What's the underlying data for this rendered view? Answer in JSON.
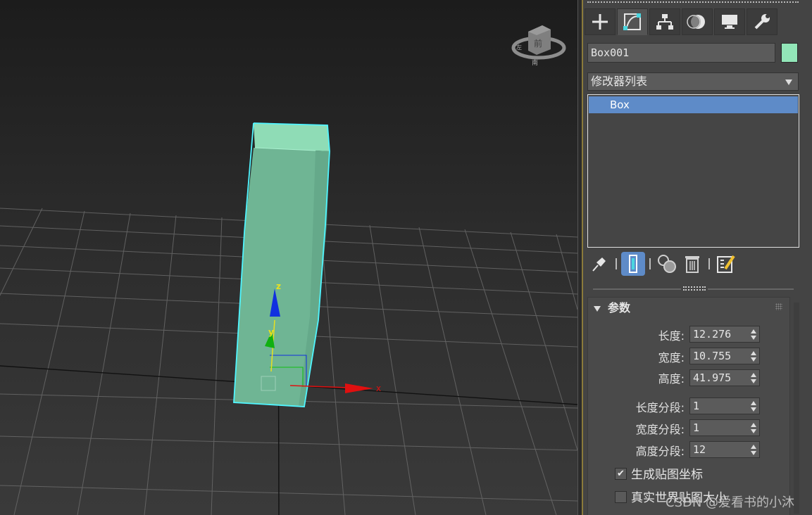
{
  "viewport": {
    "gizmo_axes": {
      "z": "z",
      "y": "y",
      "x": "x"
    },
    "viewcube": {
      "face_label": "前",
      "top_label": "左",
      "bottom_label": "南"
    }
  },
  "command_panel": {
    "tabs": [
      {
        "name": "create-tab",
        "icon": "plus-icon"
      },
      {
        "name": "modify-tab",
        "icon": "modify-curve-icon"
      },
      {
        "name": "hierarchy-tab",
        "icon": "hierarchy-icon"
      },
      {
        "name": "motion-tab",
        "icon": "motion-icon"
      },
      {
        "name": "display-tab",
        "icon": "monitor-icon"
      },
      {
        "name": "utilities-tab",
        "icon": "wrench-icon"
      }
    ],
    "object_name": "Box001",
    "object_color": "#92e6b8",
    "modifier_list_label": "修改器列表",
    "stack_items": [
      "Box"
    ],
    "stack_tools": [
      "pin-icon",
      "show-end-result-icon",
      "make-unique-icon",
      "delete-modifier-icon",
      "configure-sets-icon"
    ]
  },
  "parameters": {
    "header": "参数",
    "length_label": "长度:",
    "length_value": "12.276",
    "width_label": "宽度:",
    "width_value": "10.755",
    "height_label": "高度:",
    "height_value": "41.975",
    "length_segs_label": "长度分段:",
    "length_segs_value": "1",
    "width_segs_label": "宽度分段:",
    "width_segs_value": "1",
    "height_segs_label": "高度分段:",
    "height_segs_value": "12",
    "gen_map_coords_label": "生成贴图坐标",
    "gen_map_coords_checked": true,
    "real_world_label": "真实世界贴图大小",
    "real_world_checked": false
  },
  "watermark": "CSDN @爱看书的小沐",
  "colors": {
    "box_front": "#6fb594",
    "box_top": "#8fdcb6",
    "selection_outline": "#4ff5ff",
    "accent_blue": "#5e8bc8",
    "gizmo_x": "#e01010",
    "gizmo_y": "#10c010",
    "gizmo_z": "#1030e0"
  }
}
